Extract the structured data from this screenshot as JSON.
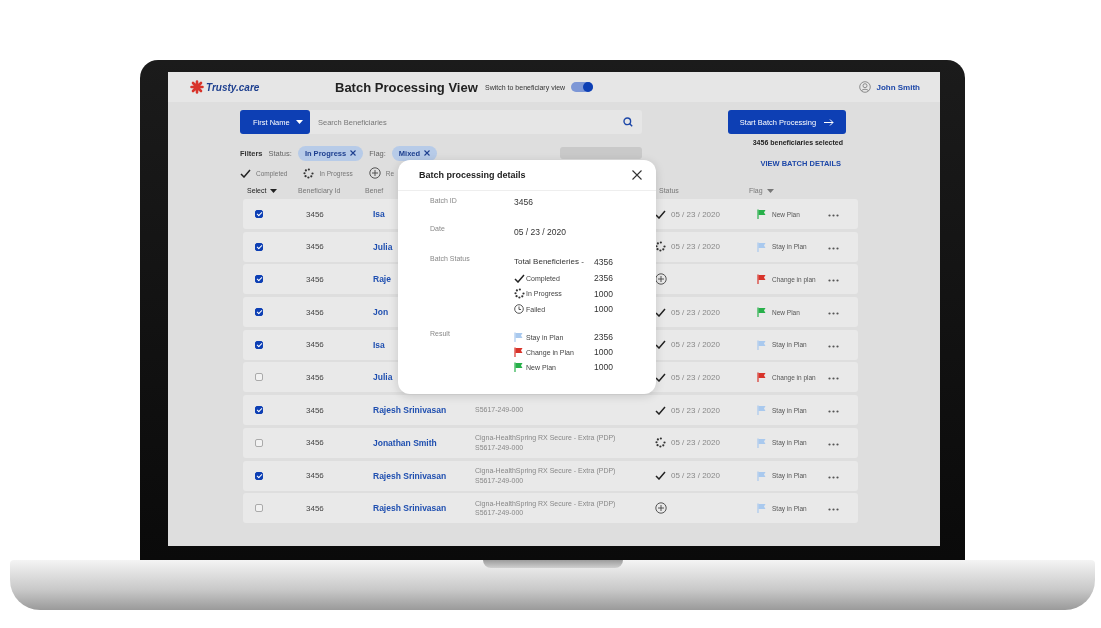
{
  "header": {
    "brand": "Trusty.care",
    "title": "Batch Processing View",
    "toggle": {
      "label": "Switch to beneficiary view",
      "on": true
    },
    "user": "John Smith"
  },
  "search": {
    "field_menu": "First Name",
    "placeholder": "Search Beneficiaries"
  },
  "actions": {
    "start_button": "Start Batch Processing",
    "selected_count": "3456 beneficiaries selected",
    "details_link": "VIEW BATCH DETAILS"
  },
  "filters": {
    "label": "Filters",
    "groups": [
      {
        "label": "Status:",
        "chip": "In Progress"
      },
      {
        "label": "Flag:",
        "chip": "Mixed"
      }
    ]
  },
  "legend": [
    {
      "kind": "done",
      "label": "Completed"
    },
    {
      "kind": "progress",
      "label": "In Progress"
    },
    {
      "kind": "added",
      "label": "Re"
    }
  ],
  "table": {
    "columns": [
      {
        "label": "Select",
        "dropdown": true
      },
      {
        "label": "Beneficiary Id",
        "dropdown": false
      },
      {
        "label": "Benef",
        "dropdown": false
      },
      {
        "label": "Status",
        "dropdown": false
      },
      {
        "label": "Flag",
        "dropdown": true
      }
    ],
    "rows": [
      {
        "checked": true,
        "id": "3456",
        "name": "Isa",
        "status": {
          "kind": "done",
          "date": "05 / 23 / 2020"
        },
        "flag": {
          "label": "New Plan",
          "color": "#27b04a"
        }
      },
      {
        "checked": true,
        "id": "3456",
        "name": "Julia",
        "status": {
          "kind": "progress",
          "date": "05 / 23 / 2020"
        },
        "flag": {
          "label": "Stay in Plan",
          "color": "#a9c9ee"
        }
      },
      {
        "checked": true,
        "id": "3456",
        "name": "Raje",
        "status": {
          "kind": "added"
        },
        "flag": {
          "label": "Change in plan",
          "color": "#d8332a"
        }
      },
      {
        "checked": true,
        "id": "3456",
        "name": "Jon",
        "status": {
          "kind": "done",
          "date": "05 / 23 / 2020"
        },
        "flag": {
          "label": "New Plan",
          "color": "#27b04a"
        }
      },
      {
        "checked": true,
        "id": "3456",
        "name": "Isa",
        "status": {
          "kind": "done",
          "date": "05 / 23 / 2020"
        },
        "flag": {
          "label": "Stay in Plan",
          "color": "#a9c9ee"
        }
      },
      {
        "checked": false,
        "id": "3456",
        "name": "Julia",
        "status": {
          "kind": "done",
          "date": "05 / 23 / 2020"
        },
        "flag": {
          "label": "Change in plan",
          "color": "#d8332a"
        }
      },
      {
        "checked": true,
        "id": "3456",
        "name": "Rajesh Srinivasan",
        "plan_id": "S5617-249-000",
        "status": {
          "kind": "done",
          "date": "05 / 23 / 2020"
        },
        "flag": {
          "label": "Stay in Plan",
          "color": "#a9c9ee"
        }
      },
      {
        "checked": false,
        "id": "3456",
        "name": "Jonathan Smith",
        "plan_name": "Cigna-HealthSpring RX Secure - Extra (PDP)",
        "plan_id": "S5617-249-000",
        "status": {
          "kind": "progress",
          "date": "05 / 23 / 2020"
        },
        "flag": {
          "label": "Stay in Plan",
          "color": "#a9c9ee"
        }
      },
      {
        "checked": true,
        "id": "3456",
        "name": "Rajesh Srinivasan",
        "plan_name": "Cigna-HealthSpring RX Secure - Extra (PDP)",
        "plan_id": "S5617-249-000",
        "status": {
          "kind": "done",
          "date": "05 / 23 / 2020"
        },
        "flag": {
          "label": "Stay in Plan",
          "color": "#a9c9ee"
        }
      },
      {
        "checked": false,
        "id": "3456",
        "name": "Rajesh Srinivasan",
        "plan_name": "Cigna-HealthSpring RX Secure - Extra (PDP)",
        "plan_id": "S5617-249-000",
        "status": {
          "kind": "added"
        },
        "flag": {
          "label": "Stay in Plan",
          "color": "#a9c9ee"
        }
      }
    ]
  },
  "modal": {
    "title": "Batch processing details",
    "batch_id_label": "Batch ID",
    "batch_id": "3456",
    "date_label": "Date",
    "date": "05 / 23 / 2020",
    "status_label": "Batch Status",
    "total_label": "Total Beneficieries -",
    "total": "4356",
    "statuses": [
      {
        "kind": "done",
        "label": "Completed",
        "count": "2356"
      },
      {
        "kind": "progress",
        "label": "In Progress",
        "count": "1000"
      },
      {
        "kind": "failed",
        "label": "Failed",
        "count": "1000"
      }
    ],
    "result_label": "Result",
    "results": [
      {
        "label": "Stay in Plan",
        "count": "2356",
        "color": "#a9c9ee"
      },
      {
        "label": "Change in Plan",
        "count": "1000",
        "color": "#d8332a"
      },
      {
        "label": "New Plan",
        "count": "1000",
        "color": "#27b04a"
      }
    ]
  }
}
